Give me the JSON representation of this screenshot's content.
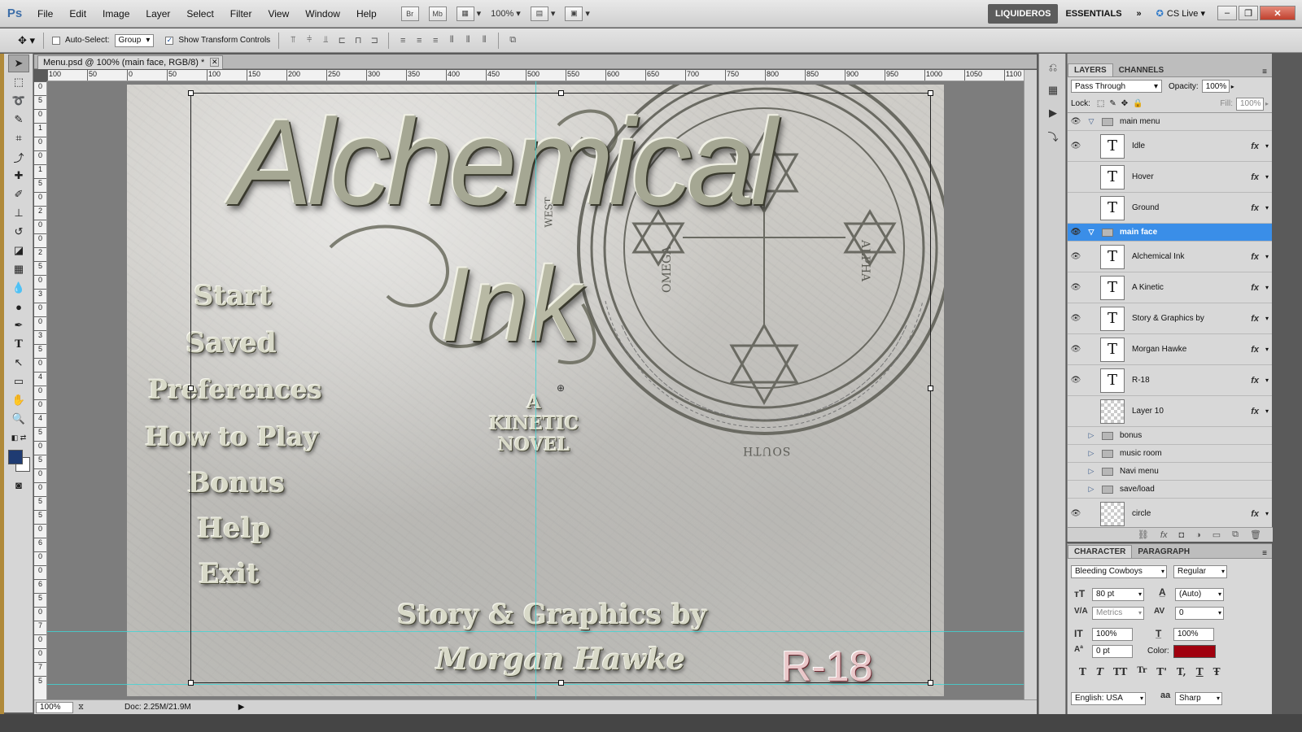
{
  "app": {
    "logo": "Ps",
    "menus": [
      "File",
      "Edit",
      "Image",
      "Layer",
      "Select",
      "Filter",
      "View",
      "Window",
      "Help"
    ],
    "bridge": "Br",
    "minibridge": "Mb",
    "zoom": "100%",
    "workspaces": [
      "LIQUIDEROS",
      "ESSENTIALS"
    ],
    "more": "»",
    "cslive": "CS Live",
    "window_buttons": [
      "–",
      "❐",
      "✕"
    ]
  },
  "options": {
    "auto_select_label": "Auto-Select:",
    "auto_select_value": "Group",
    "show_transform_label": "Show Transform Controls"
  },
  "document": {
    "tab_title": "Menu.psd @ 100% (main face, RGB/8) *",
    "ruler_top": [
      "100",
      "50",
      "0",
      "50",
      "100",
      "150",
      "200",
      "250",
      "300",
      "350",
      "400",
      "450",
      "500",
      "550",
      "600",
      "650",
      "700",
      "750",
      "800",
      "850",
      "900",
      "950",
      "1000",
      "1050",
      "1100"
    ],
    "ruler_left": [
      "0",
      "5",
      "0",
      "1",
      "0",
      "0",
      "1",
      "5",
      "0",
      "2",
      "0",
      "0",
      "2",
      "5",
      "0",
      "3",
      "0",
      "0",
      "3",
      "5",
      "0",
      "4",
      "0",
      "0",
      "4",
      "5",
      "0",
      "5",
      "0",
      "0",
      "5",
      "5",
      "0",
      "6",
      "0",
      "0",
      "6",
      "5",
      "0",
      "7",
      "0",
      "0",
      "7",
      "5"
    ],
    "status_zoom": "100%",
    "status_doc": "Doc: 2.25M/21.9M"
  },
  "artwork": {
    "title_line1": "Alchemical",
    "title_line2": "Ink",
    "menu_options": [
      "Start",
      "Saved",
      "Preferences",
      "How to Play",
      "Bonus",
      "Help",
      "Exit"
    ],
    "kinetic": [
      "A",
      "KINETIC",
      "NOVEL"
    ],
    "story_by": "Story & Graphics by",
    "author": "Morgan Hawke",
    "rating": "R-18",
    "sigil_words": [
      "WEST",
      "OMEGA",
      "ALPHA",
      "SOUTH"
    ]
  },
  "layers_panel": {
    "tabs": [
      "LAYERS",
      "CHANNELS"
    ],
    "blend_mode": "Pass Through",
    "opacity_label": "Opacity:",
    "opacity": "100%",
    "lock_label": "Lock:",
    "fill_label": "Fill:",
    "fill": "100%",
    "items": [
      {
        "kind": "group",
        "name": "main menu",
        "open": true,
        "visible": true,
        "selected": false
      },
      {
        "kind": "text",
        "name": "Idle",
        "visible": true,
        "fx": true
      },
      {
        "kind": "text",
        "name": "Hover",
        "visible": false,
        "fx": true
      },
      {
        "kind": "text",
        "name": "Ground",
        "visible": false,
        "fx": true
      },
      {
        "kind": "group",
        "name": "main face",
        "open": true,
        "visible": true,
        "selected": true
      },
      {
        "kind": "text",
        "name": "Alchemical Ink",
        "visible": true,
        "fx": true
      },
      {
        "kind": "text",
        "name": "A Kinetic",
        "visible": true,
        "fx": true
      },
      {
        "kind": "text",
        "name": "Story & Graphics by",
        "visible": true,
        "fx": true
      },
      {
        "kind": "text",
        "name": "Morgan Hawke",
        "visible": true,
        "fx": true
      },
      {
        "kind": "text",
        "name": "R-18",
        "visible": true,
        "fx": true
      },
      {
        "kind": "pixel",
        "name": "Layer 10",
        "visible": false,
        "fx": true
      },
      {
        "kind": "group",
        "name": "bonus",
        "open": false,
        "visible": false,
        "selected": false
      },
      {
        "kind": "group",
        "name": "music room",
        "open": false,
        "visible": false,
        "selected": false
      },
      {
        "kind": "group",
        "name": "Navi menu",
        "open": false,
        "visible": false,
        "selected": false
      },
      {
        "kind": "group",
        "name": "save/load",
        "open": false,
        "visible": false,
        "selected": false
      },
      {
        "kind": "pixel",
        "name": "circle",
        "visible": true,
        "fx": true
      }
    ]
  },
  "character_panel": {
    "tabs": [
      "CHARACTER",
      "PARAGRAPH"
    ],
    "font_family": "Bleeding Cowboys",
    "font_style": "Regular",
    "font_size": "80 pt",
    "leading": "(Auto)",
    "kerning": "Metrics",
    "tracking": "0",
    "vscale": "100%",
    "hscale": "100%",
    "baseline": "0 pt",
    "color_label": "Color:",
    "color": "#a0000e",
    "style_buttons": [
      "T",
      "T",
      "TT",
      "Tr",
      "T'",
      "T,",
      "T",
      "Ŧ"
    ],
    "language": "English: USA",
    "aa_label": "aa",
    "antialias": "Sharp"
  },
  "colors": {
    "selection": "#3a8ee8",
    "guides": "#3fd6d6",
    "foreground": "#1f3b72"
  }
}
